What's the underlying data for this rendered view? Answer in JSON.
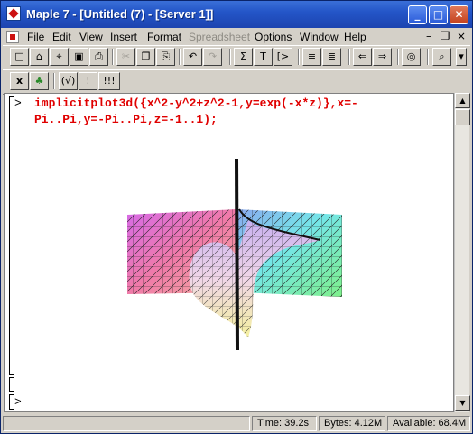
{
  "window": {
    "title": "Maple 7  - [Untitled (7) - [Server 1]]",
    "controls": [
      "minimize",
      "maximize",
      "close"
    ]
  },
  "menubar": {
    "items": [
      {
        "label": "File",
        "disabled": false
      },
      {
        "label": "Edit",
        "disabled": false
      },
      {
        "label": "View",
        "disabled": false
      },
      {
        "label": "Insert",
        "disabled": false
      },
      {
        "label": "Format",
        "disabled": false
      },
      {
        "label": "Spreadsheet",
        "disabled": true
      },
      {
        "label": "Options",
        "disabled": false
      },
      {
        "label": "Window",
        "disabled": false
      },
      {
        "label": "Help",
        "disabled": false
      }
    ],
    "mdi_controls": [
      "_",
      "̲❐",
      "×"
    ]
  },
  "toolbar": {
    "buttons": [
      {
        "name": "new-document-icon",
        "glyph": "□"
      },
      {
        "name": "open-folder-icon",
        "glyph": "⌂"
      },
      {
        "name": "open-url-icon",
        "glyph": "⌖"
      },
      {
        "name": "save-icon",
        "glyph": "▣"
      },
      {
        "name": "print-icon",
        "glyph": "⎙"
      },
      {
        "name": "cut-icon",
        "glyph": "✂",
        "disabled": true
      },
      {
        "name": "copy-icon",
        "glyph": "❐"
      },
      {
        "name": "paste-icon",
        "glyph": "⎘"
      },
      {
        "name": "undo-icon",
        "glyph": "↶"
      },
      {
        "name": "redo-icon",
        "glyph": "↷",
        "disabled": true
      },
      {
        "name": "sum-icon",
        "glyph": "Σ"
      },
      {
        "name": "text-icon",
        "glyph": "T"
      },
      {
        "name": "execution-group-icon",
        "glyph": "[>"
      },
      {
        "name": "collapse-section-icon",
        "glyph": "≡"
      },
      {
        "name": "expand-section-icon",
        "glyph": "≣"
      },
      {
        "name": "back-arrow-icon",
        "glyph": "⇐"
      },
      {
        "name": "forward-arrow-icon",
        "glyph": "⇒"
      },
      {
        "name": "stop-icon",
        "glyph": "◎"
      },
      {
        "name": "zoom-icon",
        "glyph": "⌕"
      }
    ],
    "context_buttons": [
      {
        "name": "interrupt-icon",
        "glyph": "x"
      },
      {
        "name": "maple-leaf-icon",
        "glyph": "♣"
      },
      {
        "name": "check-syntax-icon",
        "glyph": "(√)"
      },
      {
        "name": "execute-icon",
        "glyph": "!"
      },
      {
        "name": "execute-all-icon",
        "glyph": "!!!"
      }
    ]
  },
  "document": {
    "prompt_symbol": ">",
    "command_line1": "implicitplot3d({x^2-y^2+z^2-1,y=exp(-x*z)},x=-",
    "command_line2": "Pi..Pi,y=-Pi..Pi,z=-1..1);",
    "empty_group_symbol": "[",
    "final_prompt": ">"
  },
  "status": {
    "time": "Time:  39.2s",
    "bytes": "Bytes: 4.12M",
    "available": "Available: 68.4M"
  },
  "colors": {
    "title_bar": "#2456c8",
    "command_text": "#e00000",
    "document_bg": "#ffffff"
  }
}
